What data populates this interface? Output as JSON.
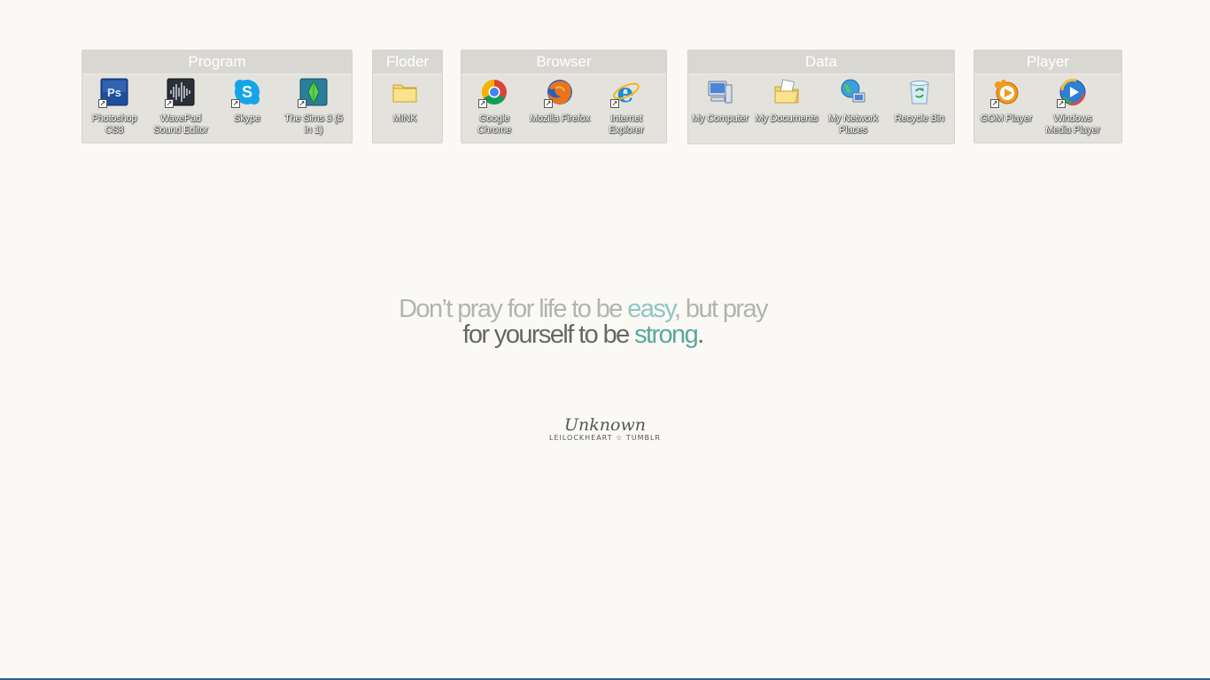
{
  "fences": {
    "program": {
      "title": "Program",
      "icons": [
        {
          "label": "Photoshop CS3",
          "icon": "photoshop-icon"
        },
        {
          "label": "WavePad Sound Editor",
          "icon": "wavepad-icon"
        },
        {
          "label": "Skype",
          "icon": "skype-icon"
        },
        {
          "label": "The Sims 3 (5 in 1)",
          "icon": "sims-icon"
        }
      ]
    },
    "floder": {
      "title": "Floder",
      "icons": [
        {
          "label": "MINK",
          "icon": "folder-icon"
        }
      ]
    },
    "browser": {
      "title": "Browser",
      "icons": [
        {
          "label": "Google Chrome",
          "icon": "chrome-icon"
        },
        {
          "label": "Mozilla Firefox",
          "icon": "firefox-icon"
        },
        {
          "label": "Internet Explorer",
          "icon": "ie-icon"
        }
      ]
    },
    "data": {
      "title": "Data",
      "icons": [
        {
          "label": "My Computer",
          "icon": "computer-icon"
        },
        {
          "label": "My Documents",
          "icon": "documents-icon"
        },
        {
          "label": "My Network Places",
          "icon": "network-icon"
        },
        {
          "label": "Recycle Bin",
          "icon": "recycle-bin-icon"
        }
      ]
    },
    "player": {
      "title": "Player",
      "icons": [
        {
          "label": "GOM Player",
          "icon": "gom-player-icon"
        },
        {
          "label": "Windows Media Player",
          "icon": "wmp-icon"
        }
      ]
    }
  },
  "quote": {
    "line1_a": "Don’t pray for life to be ",
    "line1_b": "easy",
    "line1_c": ", but pray",
    "line2_a": "for yourself to be ",
    "line2_b": "strong",
    "line2_c": "."
  },
  "signature": {
    "name": "Unknown",
    "credit": "LEILOCKHEART ☆ TUMBLR"
  },
  "colors": {
    "background": "#faf9f5",
    "fence": "#e4e2dd",
    "accent_light": "#8fc6c2",
    "accent_dark": "#5ba6a0",
    "taskbar_edge": "#2f5f8f"
  }
}
